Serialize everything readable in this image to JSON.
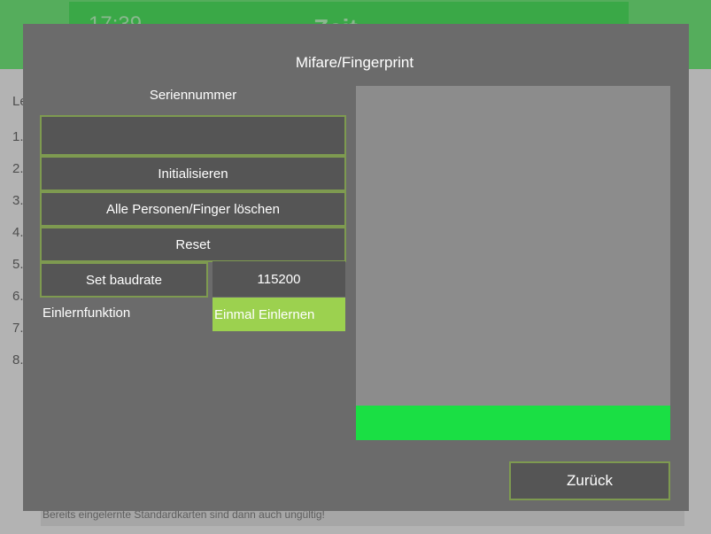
{
  "background": {
    "time": "17:39",
    "title": "Zeit...",
    "left_items": [
      "Le",
      "1.",
      "2.",
      "3.",
      "4.",
      "5.",
      "6.",
      "7.",
      "8."
    ],
    "footer_text": "Bereits eingelernte Standardkarten sind dann auch ungültig!"
  },
  "dialog": {
    "title": "Mifare/Fingerprint",
    "serial_label": "Seriennummer",
    "serial_value": "",
    "buttons": {
      "initialize": "Initialisieren",
      "delete_all": "Alle Personen/Finger löschen",
      "reset": "Reset",
      "set_baudrate": "Set baudrate",
      "back": "Zurück"
    },
    "baudrate_value": "115200",
    "learn_label": "Einlernfunktion",
    "learn_value": "Einmal Einlernen",
    "progress_fraction": 1.0
  },
  "colors": {
    "accent_green": "#9cd14f",
    "progress_green": "#1adf44",
    "button_border": "#7e9a50"
  }
}
